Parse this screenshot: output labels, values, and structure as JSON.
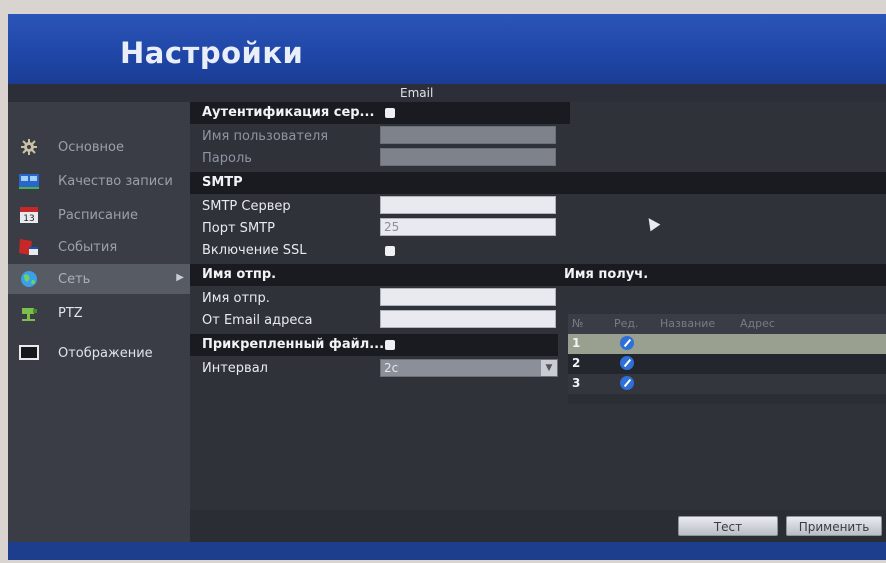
{
  "header": {
    "title": "Настройки",
    "section_title": "Email"
  },
  "sidebar": {
    "items": [
      {
        "label": "Основное",
        "icon": "gear-icon"
      },
      {
        "label": "Качество записи",
        "icon": "video-quality-icon"
      },
      {
        "label": "Расписание",
        "icon": "calendar-icon"
      },
      {
        "label": "События",
        "icon": "event-icon"
      },
      {
        "label": "Сеть",
        "icon": "network-globe-icon",
        "active": true
      },
      {
        "label": "PTZ",
        "icon": "ptz-camera-icon"
      },
      {
        "label": "Отображение",
        "icon": "monitor-icon"
      }
    ]
  },
  "form": {
    "auth": {
      "label": "Аутентификация сер...",
      "checked": false
    },
    "username": {
      "label": "Имя пользователя",
      "value": ""
    },
    "password": {
      "label": "Пароль",
      "value": ""
    },
    "smtp_header": "SMTP",
    "smtp_server": {
      "label": "SMTP Сервер",
      "value": ""
    },
    "smtp_port": {
      "label": "Порт SMTP",
      "value": "25"
    },
    "ssl": {
      "label": "Включение SSL",
      "checked": false
    },
    "sender_header": "Имя отпр.",
    "sender_name": {
      "label": "Имя отпр.",
      "value": ""
    },
    "sender_email": {
      "label": "От Email адреса",
      "value": ""
    },
    "attach": {
      "label": "Прикрепленный файл...",
      "checked": false
    },
    "interval": {
      "label": "Интервал",
      "value": "2с"
    }
  },
  "recipients": {
    "header": "Имя получ.",
    "columns": [
      "№",
      "Ред.",
      "Название",
      "Адрес"
    ],
    "rows": [
      {
        "no": "1",
        "selected": true
      },
      {
        "no": "2",
        "selected": false
      },
      {
        "no": "3",
        "selected": false
      }
    ]
  },
  "buttons": {
    "test": "Тест",
    "apply": "Применить"
  },
  "colors": {
    "title_bar": "#2352b4",
    "accent_edit": "#2f6fd8",
    "selected_row": "#9aa08f"
  }
}
